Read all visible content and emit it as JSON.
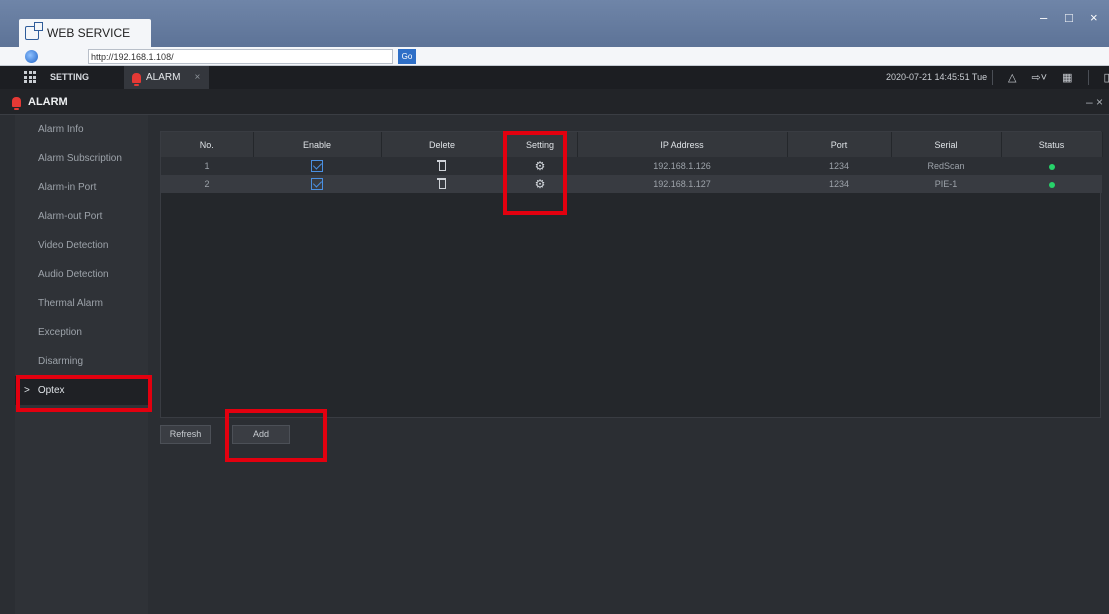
{
  "browser": {
    "tab_title": "WEB SERVICE",
    "url": "http://192.168.1.108/",
    "go_label": "Go",
    "controls": {
      "minimize": "–",
      "maximize": "□",
      "close": "×"
    }
  },
  "appbar": {
    "setting_label": "SETTING",
    "alarm_tab_label": "ALARM",
    "alarm_tab_close": "×",
    "datetime": "2020-07-21 14:45:51 Tue"
  },
  "module": {
    "title": "ALARM",
    "close": "– ×"
  },
  "sidebar": {
    "items": [
      {
        "label": "Alarm Info"
      },
      {
        "label": "Alarm Subscription"
      },
      {
        "label": "Alarm-in Port"
      },
      {
        "label": "Alarm-out Port"
      },
      {
        "label": "Video Detection"
      },
      {
        "label": "Audio Detection"
      },
      {
        "label": "Thermal Alarm"
      },
      {
        "label": "Exception"
      },
      {
        "label": "Disarming"
      },
      {
        "label": "Optex",
        "active": true
      }
    ],
    "active_chevron": ">"
  },
  "table": {
    "columns": [
      "No.",
      "Enable",
      "Delete",
      "Setting",
      "IP Address",
      "Port",
      "Serial",
      "Status"
    ],
    "rows": [
      {
        "no": "1",
        "enabled": true,
        "ip": "192.168.1.126",
        "port": "1234",
        "serial": "RedScan",
        "status": "online"
      },
      {
        "no": "2",
        "enabled": true,
        "ip": "192.168.1.127",
        "port": "1234",
        "serial": "PIE-1",
        "status": "online"
      }
    ]
  },
  "buttons": {
    "refresh": "Refresh",
    "add": "Add"
  },
  "colors": {
    "highlight": "#e3000f",
    "status_online": "#27d36a",
    "checkbox": "#4a90e2"
  }
}
